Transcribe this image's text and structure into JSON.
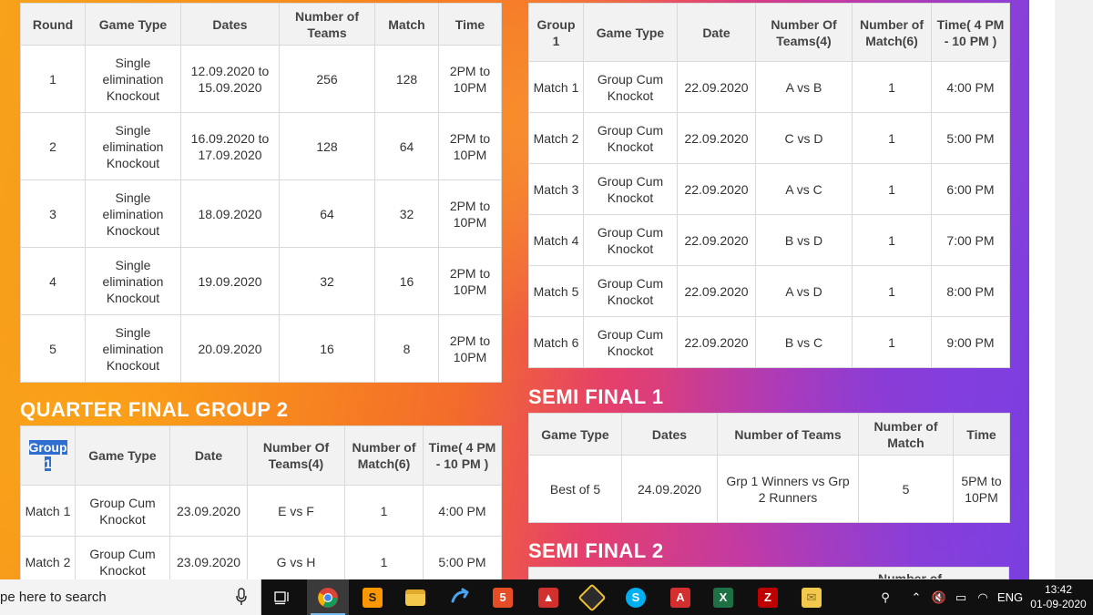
{
  "rounds_table": {
    "headers": [
      "Round",
      "Game Type",
      "Dates",
      "Number of Teams",
      "Match",
      "Time"
    ],
    "rows": [
      [
        "1",
        "Single elimination Knockout",
        "12.09.2020 to 15.09.2020",
        "256",
        "128",
        "2PM to 10PM"
      ],
      [
        "2",
        "Single elimination Knockout",
        "16.09.2020 to 17.09.2020",
        "128",
        "64",
        "2PM to 10PM"
      ],
      [
        "3",
        "Single elimination Knockout",
        "18.09.2020",
        "64",
        "32",
        "2PM to 10PM"
      ],
      [
        "4",
        "Single elimination Knockout",
        "19.09.2020",
        "32",
        "16",
        "2PM to 10PM"
      ],
      [
        "5",
        "Single elimination Knockout",
        "20.09.2020",
        "16",
        "8",
        "2PM to 10PM"
      ]
    ]
  },
  "group1_table": {
    "headers": [
      "Group 1",
      "Game Type",
      "Date",
      "Number Of Teams(4)",
      "Number of Match(6)",
      "Time( 4 PM - 10 PM )"
    ],
    "rows": [
      [
        "Match 1",
        "Group Cum Knockot",
        "22.09.2020",
        "A vs B",
        "1",
        "4:00 PM"
      ],
      [
        "Match 2",
        "Group Cum Knockot",
        "22.09.2020",
        "C vs D",
        "1",
        "5:00 PM"
      ],
      [
        "Match 3",
        "Group Cum Knockot",
        "22.09.2020",
        "A vs C",
        "1",
        "6:00 PM"
      ],
      [
        "Match 4",
        "Group Cum Knockot",
        "22.09.2020",
        "B vs D",
        "1",
        "7:00 PM"
      ],
      [
        "Match 5",
        "Group Cum Knockot",
        "22.09.2020",
        "A vs D",
        "1",
        "8:00 PM"
      ],
      [
        "Match 6",
        "Group Cum Knockot",
        "22.09.2020",
        "B vs C",
        "1",
        "9:00 PM"
      ]
    ]
  },
  "quarter_final_group2": {
    "title": "QUARTER FINAL GROUP 2",
    "headers": [
      "Group 1",
      "Game Type",
      "Date",
      "Number Of Teams(4)",
      "Number of Match(6)",
      "Time( 4 PM - 10 PM )"
    ],
    "selected_header_text": "Group 1",
    "rows": [
      [
        "Match 1",
        "Group Cum Knockot",
        "23.09.2020",
        "E vs F",
        "1",
        "4:00 PM"
      ],
      [
        "Match 2",
        "Group Cum Knockot",
        "23.09.2020",
        "G vs H",
        "1",
        "5:00 PM"
      ]
    ]
  },
  "semi_final_1": {
    "title": "SEMI FINAL 1",
    "headers": [
      "Game Type",
      "Dates",
      "Number of Teams",
      "Number of Match",
      "Time"
    ],
    "rows": [
      [
        "Best of 5",
        "24.09.2020",
        "Grp 1 Winners vs Grp 2 Runners",
        "5",
        "5PM to 10PM"
      ]
    ]
  },
  "semi_final_2": {
    "title": "SEMI FINAL 2",
    "partial_header": "Number of"
  },
  "taskbar": {
    "search_placeholder": "pe here to search",
    "apps": [
      "task-view-icon",
      "chrome-icon",
      "sublime-icon",
      "file-explorer-icon",
      "edge-arrow-icon",
      "html5-icon",
      "image-viewer-icon",
      "git-icon",
      "skype-icon",
      "acrobat-icon",
      "excel-icon",
      "filezilla-icon",
      "mail-icon"
    ],
    "language": "ENG",
    "time": "13:42",
    "date": "01-09-2020"
  },
  "colors": {
    "accent_blue": "#2f6fd1",
    "header_gray": "#f2f2f2",
    "gradient_orange": "#f7a21b",
    "gradient_purple": "#7a3fe0"
  }
}
